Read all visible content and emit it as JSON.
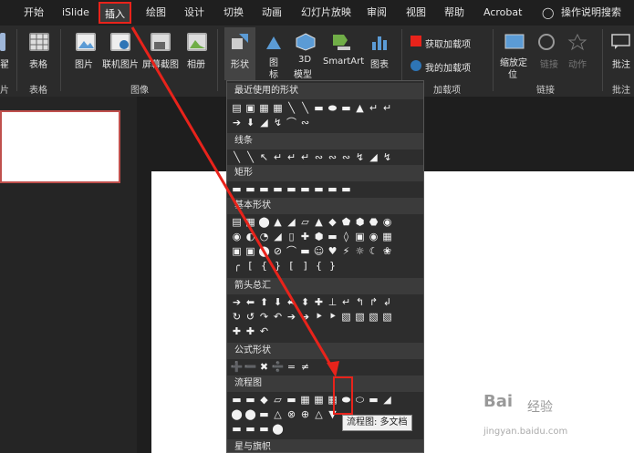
{
  "menubar": {
    "items": [
      "开始",
      "iSlide",
      "插入",
      "绘图",
      "设计",
      "切换",
      "动画",
      "幻灯片放映",
      "审阅",
      "视图",
      "帮助",
      "Acrobat",
      "操作说明搜索"
    ]
  },
  "ribbon": {
    "left_partial_1": "翟",
    "left_partial_2": "片",
    "table": "表格",
    "table_group": "表格",
    "picture": "图片",
    "online_picture": "联机图片",
    "screenshot": "屏幕截图",
    "album": "相册",
    "images_group": "图像",
    "shapes": "形状",
    "icons_1": "图",
    "icons_2": "标",
    "model_1": "3D",
    "model_2": "模型",
    "smartart": "SmartArt",
    "chart": "图表",
    "get_addins": "获取加载项",
    "my_addins": "我的加载项",
    "addins_group": "加载项",
    "zoom_1": "缩放定",
    "zoom_2": "位",
    "link": "链接",
    "action": "动作",
    "links_group": "链接",
    "comment": "批注",
    "comments_group": "批注"
  },
  "shape_menu": {
    "sections": [
      "最近使用的形状",
      "线条",
      "矩形",
      "基本形状",
      "箭头总汇",
      "公式形状",
      "流程图",
      "星与旗帜"
    ]
  },
  "tooltip": "流程图: 多文档",
  "watermark": {
    "line1": "Bai",
    "line2": "经验",
    "line3": "jingyan.baidu.com"
  },
  "colors": {
    "highlight": "#e8231b",
    "accent_blue": "#2e75b6"
  }
}
